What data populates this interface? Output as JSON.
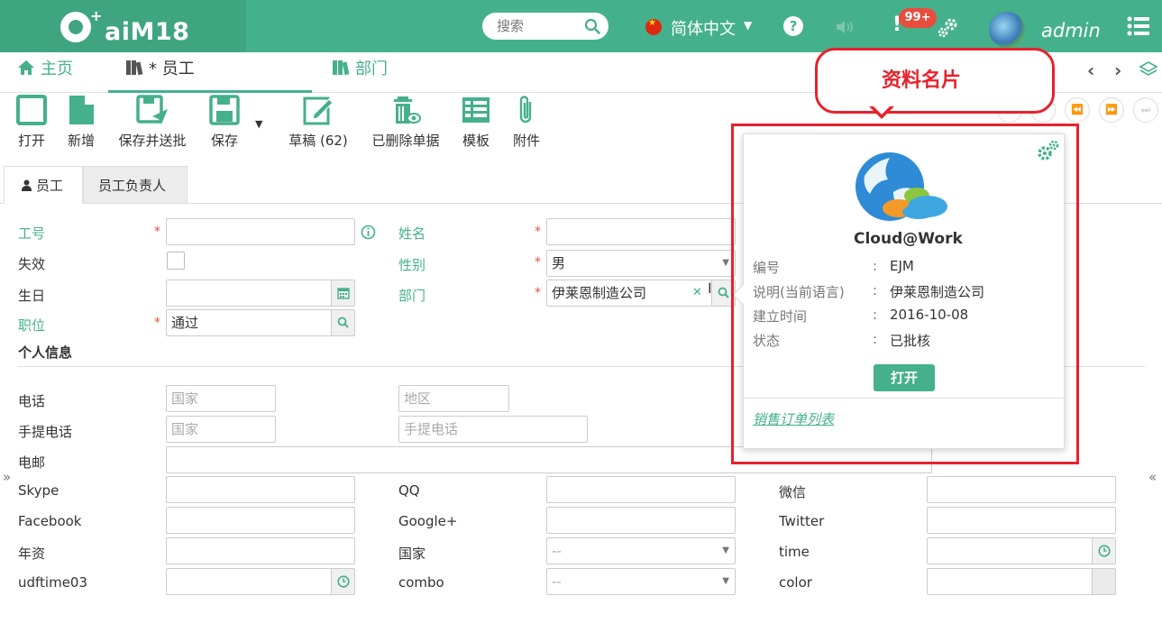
{
  "app": {
    "logo_text": "aiM18",
    "logo_plus": "+"
  },
  "topbar": {
    "search_placeholder": "搜索",
    "language": "简体中文",
    "help": "?",
    "alert_mark": "!",
    "alert_count": "99+",
    "user": "admin"
  },
  "tabs": {
    "home": "主页",
    "employee": "* 员工",
    "department": "部门"
  },
  "toolbar": {
    "open": "打开",
    "new": "新增",
    "save_submit": "保存并送批",
    "save": "保存",
    "draft": "草稿 (62)",
    "deleted": "已删除单据",
    "template": "模板",
    "attachment": "附件"
  },
  "subtabs": {
    "employee": "员工",
    "owner": "员工负责人"
  },
  "form": {
    "labels": {
      "code": "工号",
      "inactive": "失效",
      "birthday": "生日",
      "position": "职位",
      "name": "姓名",
      "gender": "性别",
      "department": "部门",
      "personal": "个人信息",
      "phone": "电话",
      "mobile": "手提电话",
      "email": "电邮",
      "skype": "Skype",
      "facebook": "Facebook",
      "seniority": "年资",
      "udftime": "udftime03",
      "qq": "QQ",
      "google": "Google+",
      "country": "国家",
      "combo": "combo",
      "wechat": "微信",
      "twitter": "Twitter",
      "time": "time",
      "color": "color"
    },
    "values": {
      "gender": "男",
      "department": "伊莱恩制造公司",
      "position": "通过",
      "country_select": "--",
      "combo_select": "--"
    },
    "placeholders": {
      "phone_country": "国家",
      "phone_area": "地区",
      "mobile_country": "国家",
      "mobile": "手提电话"
    },
    "required_mark": "*"
  },
  "callout": {
    "text": "资料名片"
  },
  "card": {
    "logo_text": "Cloud@Work",
    "rows": [
      {
        "key": "编号",
        "value": "EJM"
      },
      {
        "key": "说明(当前语言)",
        "value": "伊莱恩制造公司"
      },
      {
        "key": "建立时间",
        "value": "2016-10-08"
      },
      {
        "key": "状态",
        "value": "已批核"
      }
    ],
    "colon": ":",
    "open_button": "打开",
    "link": "销售订单列表"
  },
  "colors": {
    "brand": "#45b08c",
    "brand_dark": "#3fa581",
    "required": "#e74c3c",
    "callout": "#e8212b",
    "badge": "#e84c3d"
  }
}
